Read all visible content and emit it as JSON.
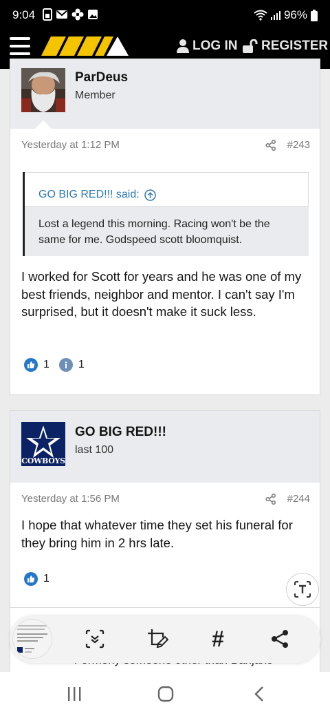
{
  "status_bar": {
    "time": "9:04",
    "battery": "96%",
    "icons": [
      "sim-icon",
      "mail-icon",
      "flower-icon",
      "image-icon",
      "wifi-icon",
      "signal-icon",
      "battery-icon"
    ]
  },
  "header": {
    "login_label": "LOG IN",
    "register_label": "REGISTER",
    "logo_color": "#f5c400"
  },
  "posts": [
    {
      "username": "ParDeus",
      "user_title": "Member",
      "date": "Yesterday at 1:12 PM",
      "post_number": "#243",
      "quote": {
        "author_line": "GO BIG RED!!! said:",
        "text": "Lost a legend this morning. Racing won't be the same for me. Godspeed scott bloomquist."
      },
      "body": "I worked for Scott for years and he was one of my best friends, neighbor and mentor. I can't say I'm surprised, but it doesn't make it suck less.",
      "reactions": [
        {
          "icon": "like-icon",
          "count": "1"
        },
        {
          "icon": "info-icon",
          "count": "1"
        }
      ]
    },
    {
      "username": "GO BIG RED!!!",
      "user_title": "last 100",
      "avatar_text": "COWBOYS",
      "date": "Yesterday at 1:56 PM",
      "post_number": "#244",
      "body": "I hope that whatever time they set his funeral for they bring him in 2 hrs late.",
      "reactions": [
        {
          "icon": "like-icon",
          "count": "1"
        }
      ]
    }
  ],
  "peek_text": "Formerly someone other than Banjaxo",
  "capture_toolbar": {
    "hash_label": "#",
    "buttons": [
      "scroll-capture-icon",
      "crop-edit-icon",
      "tag-icon",
      "share-icon"
    ]
  },
  "colors": {
    "accent_blue": "#2e79b4",
    "like_blue": "#2577c8",
    "header_bg": "#000000",
    "userbar_bg": "#e9ebee"
  }
}
